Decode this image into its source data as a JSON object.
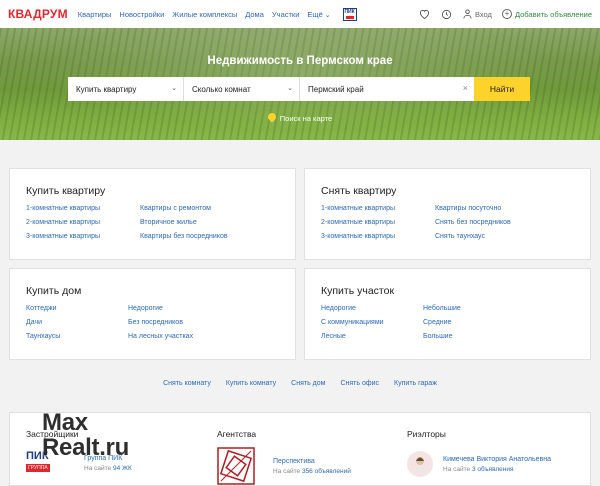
{
  "header": {
    "logo": "КВАДРУМ",
    "nav": [
      "Квартиры",
      "Новостройки",
      "Жилые комплексы",
      "Дома",
      "Участки"
    ],
    "more": "Ещё",
    "pik_badge": "ПИК",
    "login": "Вход",
    "add_ad": "Добавить объявление",
    "icons": [
      "heart-icon",
      "history-icon",
      "user-icon",
      "plus-icon"
    ]
  },
  "hero": {
    "title": "Недвижимость в Пермском крае",
    "deal_select": "Купить квартиру",
    "rooms_select": "Сколько комнат",
    "location_value": "Пермский край",
    "find_button": "Найти",
    "map_link": "Поиск на карте"
  },
  "cards": {
    "buy_flat": {
      "title": "Купить квартиру",
      "col1": [
        "1-комнатные квартиры",
        "2-комнатные квартиры",
        "3-комнатные квартиры"
      ],
      "col2": [
        "Квартиры с ремонтом",
        "Вторичное жилье",
        "Квартиры без посредников"
      ]
    },
    "rent_flat": {
      "title": "Снять квартиру",
      "col1": [
        "1-комнатные квартиры",
        "2-комнатные квартиры",
        "3-комнатные квартиры"
      ],
      "col2": [
        "Квартиры посуточно",
        "Снять без посредников",
        "Снять таунхаус"
      ]
    },
    "buy_house": {
      "title": "Купить дом",
      "col1": [
        "Коттеджи",
        "Дачи",
        "Таунхаусы"
      ],
      "col2": [
        "Недорогие",
        "Без посредников",
        "На лесных участках"
      ]
    },
    "buy_plot": {
      "title": "Купить участок",
      "col1": [
        "Недорогие",
        "С коммуникациями",
        "Лесные"
      ],
      "col2": [
        "Небольшие",
        "Средние",
        "Большие"
      ]
    }
  },
  "quick_links": [
    "Снять комнату",
    "Купить комнату",
    "Снять дом",
    "Снять офис",
    "Купить гараж"
  ],
  "bottom": {
    "developers": {
      "title": "Застройщики",
      "name": "Группа ПИК",
      "sub_prefix": "На сайте",
      "sub_value": "94 ЖК",
      "logo_top": "ПИК",
      "logo_bar": "ГРУППА"
    },
    "agencies": {
      "title": "Агентства",
      "name": "Перспектива",
      "sub_prefix": "На сайте",
      "sub_value": "356 объявлений"
    },
    "realtors": {
      "title": "Риэлторы",
      "name": "Кимечева Виктория Анатольевна",
      "sub_prefix": "На сайте",
      "sub_value": "3 объявления"
    }
  },
  "watermark": [
    "Max",
    "Realt.ru"
  ],
  "colors": {
    "brand_red": "#e3262c",
    "link_blue": "#2b69b8",
    "button_yellow": "#fdd22b",
    "add_green": "#2e8b3e"
  }
}
